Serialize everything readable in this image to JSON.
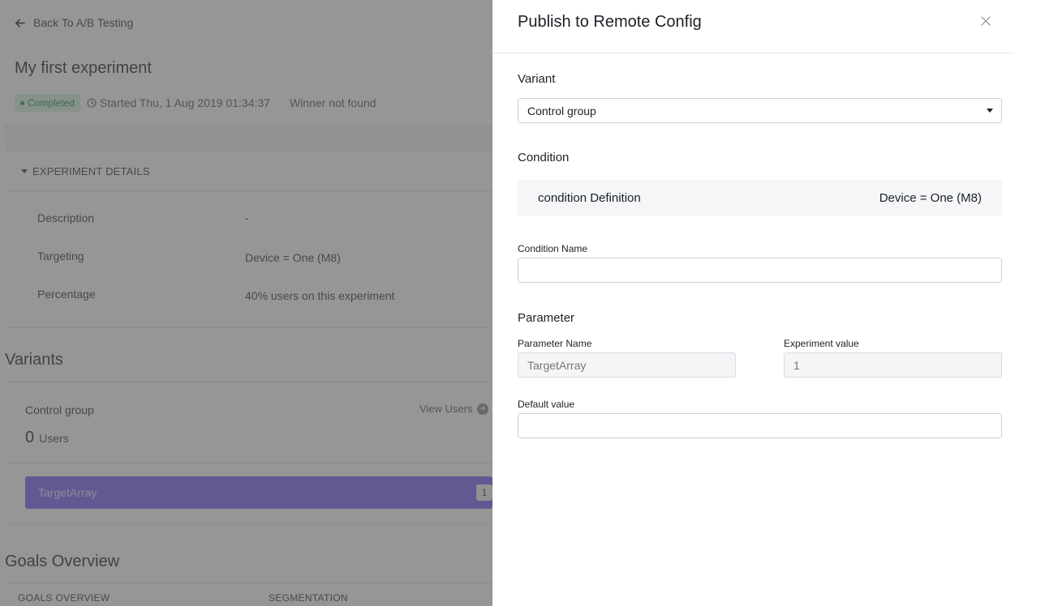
{
  "background_page": {
    "back_link": "Back To A/B Testing",
    "experiment_title": "My first experiment",
    "status_badge": "Completed",
    "started_text": "Started Thu, 1 Aug 2019 01:34:37",
    "winner_text": "Winner not found",
    "experiment_details": {
      "header": "EXPERIMENT DETAILS",
      "rows": [
        {
          "label": "Description",
          "value": "-"
        },
        {
          "label": "Targeting",
          "value": "Device = One (M8)"
        },
        {
          "label": "Percentage",
          "value": "40% users on this experiment"
        }
      ]
    },
    "variants": {
      "title": "Variants",
      "group_name": "Control group",
      "view_users": "View Users",
      "users_count": "0",
      "users_label": "Users",
      "parameter_name": "TargetArray",
      "parameter_value": "1"
    },
    "goals": {
      "title": "Goals Overview",
      "columns": [
        "GOALS OVERVIEW",
        "SEGMENTATION"
      ]
    },
    "colors": {
      "overlay": "#555555",
      "completed_badge_bg": "#d4f2df",
      "completed_badge_text": "#1e8a4c",
      "parameter_bar": "#7b5cf5"
    }
  },
  "drawer": {
    "title": "Publish to Remote Config",
    "close_icon": "close-icon",
    "variant": {
      "section_title": "Variant",
      "selected": "Control group"
    },
    "condition": {
      "section_title": "Condition",
      "definition_label": "condition Definition",
      "definition_value": "Device = One (M8)",
      "name_label": "Condition Name",
      "name_value": ""
    },
    "parameter": {
      "section_title": "Parameter",
      "name_label": "Parameter Name",
      "name_placeholder": "TargetArray",
      "experiment_value_label": "Experiment value",
      "experiment_value_placeholder": "1",
      "default_value_label": "Default value",
      "default_value": ""
    }
  }
}
